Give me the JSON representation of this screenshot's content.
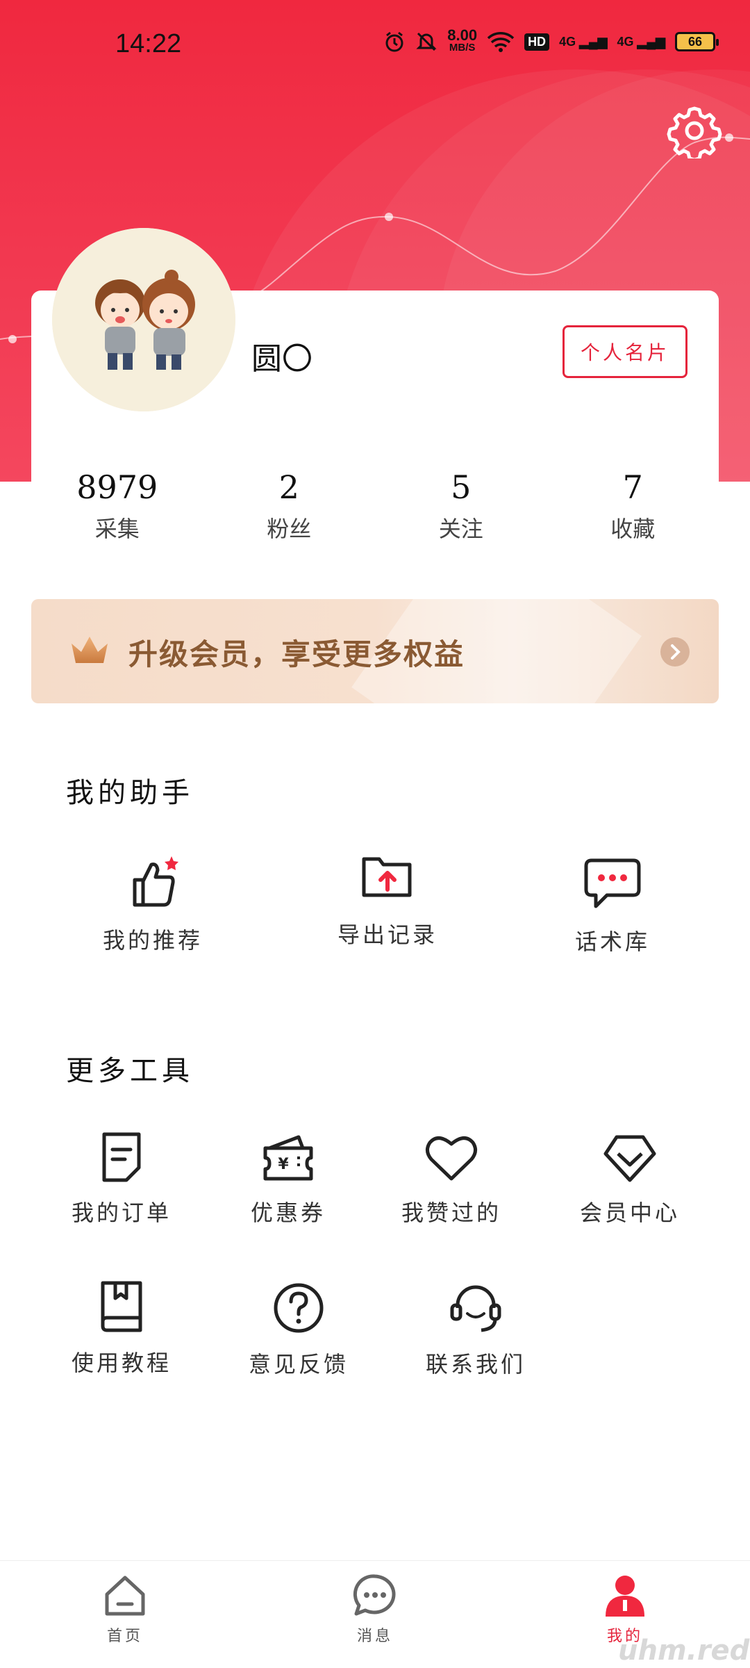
{
  "status_bar": {
    "time": "14:22",
    "net_speed_value": "8.00",
    "net_speed_unit": "MB/S",
    "hd_badge": "HD",
    "signal1": "4G",
    "signal2": "4G",
    "battery": "66"
  },
  "profile": {
    "username": "圆〇",
    "namecard_button": "个人名片"
  },
  "stats": [
    {
      "value": "8979",
      "label": "采集"
    },
    {
      "value": "2",
      "label": "粉丝"
    },
    {
      "value": "5",
      "label": "关注"
    },
    {
      "value": "7",
      "label": "收藏"
    }
  ],
  "vip_banner": {
    "text": "升级会员，享受更多权益"
  },
  "assistant": {
    "title": "我的助手",
    "items": [
      {
        "label": "我的推荐",
        "icon": "thumbs-up-icon"
      },
      {
        "label": "导出记录",
        "icon": "folder-upload-icon"
      },
      {
        "label": "话术库",
        "icon": "chat-bubble-icon"
      }
    ]
  },
  "tools": {
    "title": "更多工具",
    "items": [
      {
        "label": "我的订单",
        "icon": "order-icon"
      },
      {
        "label": "优惠券",
        "icon": "coupon-icon"
      },
      {
        "label": "我赞过的",
        "icon": "heart-icon"
      },
      {
        "label": "会员中心",
        "icon": "diamond-icon"
      },
      {
        "label": "使用教程",
        "icon": "book-icon"
      },
      {
        "label": "意见反馈",
        "icon": "question-icon"
      },
      {
        "label": "联系我们",
        "icon": "headset-icon"
      }
    ]
  },
  "tabbar": {
    "items": [
      {
        "label": "首页",
        "icon": "home-icon"
      },
      {
        "label": "消息",
        "icon": "message-icon"
      },
      {
        "label": "我的",
        "icon": "user-icon"
      }
    ],
    "active": "我的"
  },
  "watermark": "uhm.red",
  "colors": {
    "brand_red": "#e5243c",
    "vip_text": "#8a5a33"
  }
}
